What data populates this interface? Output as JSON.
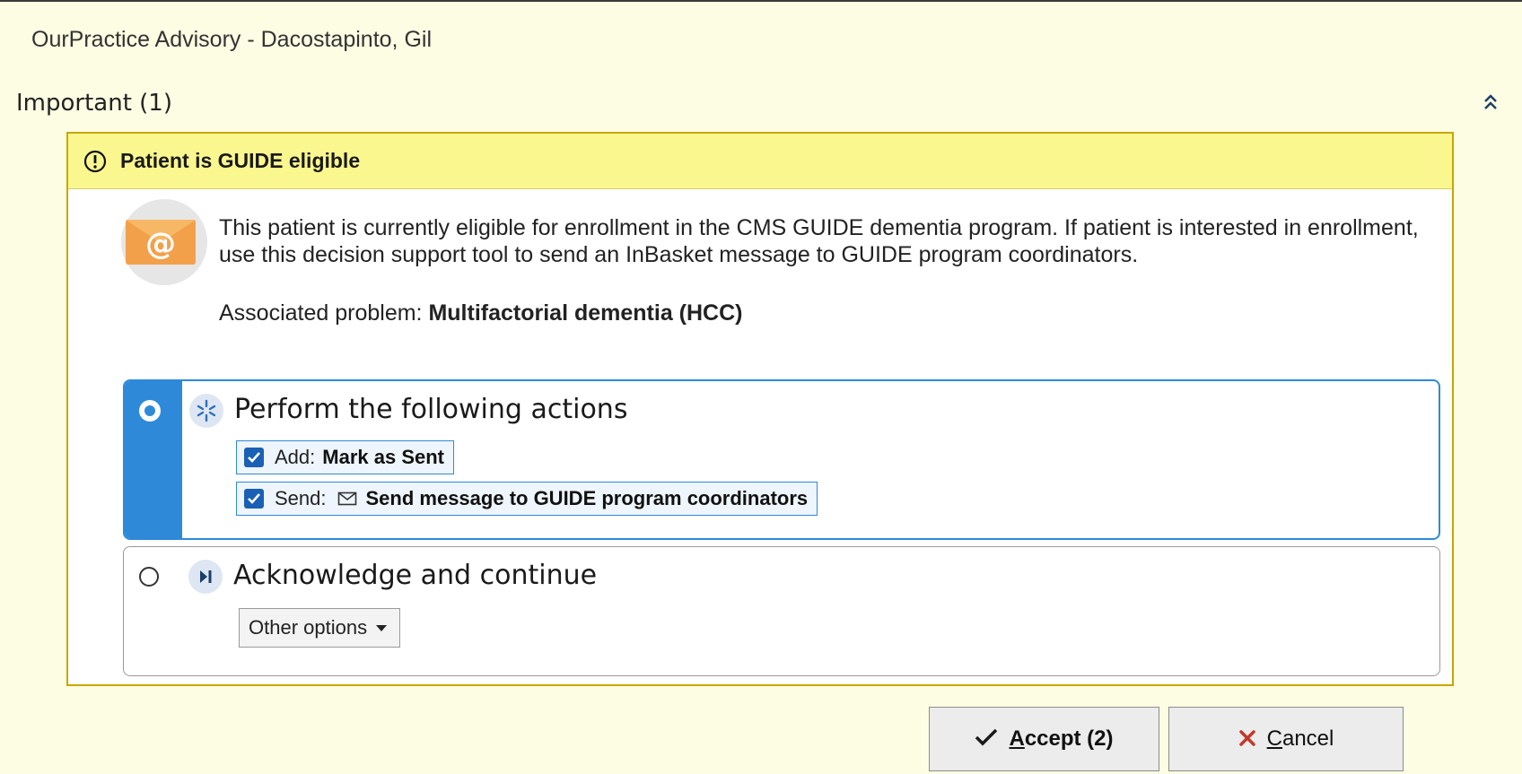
{
  "window": {
    "title": "OurPractice Advisory - Dacostapinto, Gil"
  },
  "section": {
    "label": "Important (1)",
    "collapse_icon": "double-chevron-up-icon"
  },
  "advisory": {
    "title": "Patient is GUIDE eligible",
    "warn_icon": "exclamation-circle-icon",
    "email_icon": "email-at-icon",
    "message": "This patient is currently eligible for enrollment in the CMS GUIDE dementia program. If patient is interested in enrollment, use this decision support tool to send an InBasket message to GUIDE program coordinators.",
    "assoc_label": "Associated problem: ",
    "assoc_value": "Multifactorial dementia (HCC)"
  },
  "options": {
    "perform": {
      "title": "Perform the following actions",
      "selected": true,
      "icon": "asterisk-sparkle-icon",
      "actions": [
        {
          "prefix": "Add:",
          "name": "Mark as Sent",
          "checked": true
        },
        {
          "prefix": "Send:",
          "name": "Send message to GUIDE program coordinators",
          "checked": true,
          "icon": "envelope-icon"
        }
      ]
    },
    "acknowledge": {
      "title": "Acknowledge and continue",
      "selected": false,
      "icon": "skip-forward-icon",
      "other_options_label": "Other options"
    }
  },
  "buttons": {
    "accept_letter": "A",
    "accept_rest": "ccept (2)",
    "cancel_letter": "C",
    "cancel_rest": "ancel"
  },
  "colors": {
    "accent": "#2e8ad8",
    "header_yellow": "#fbf78f",
    "border_gold": "#c8a600",
    "cancel_x": "#c0392b",
    "accept_check": "#1a1a1a"
  }
}
